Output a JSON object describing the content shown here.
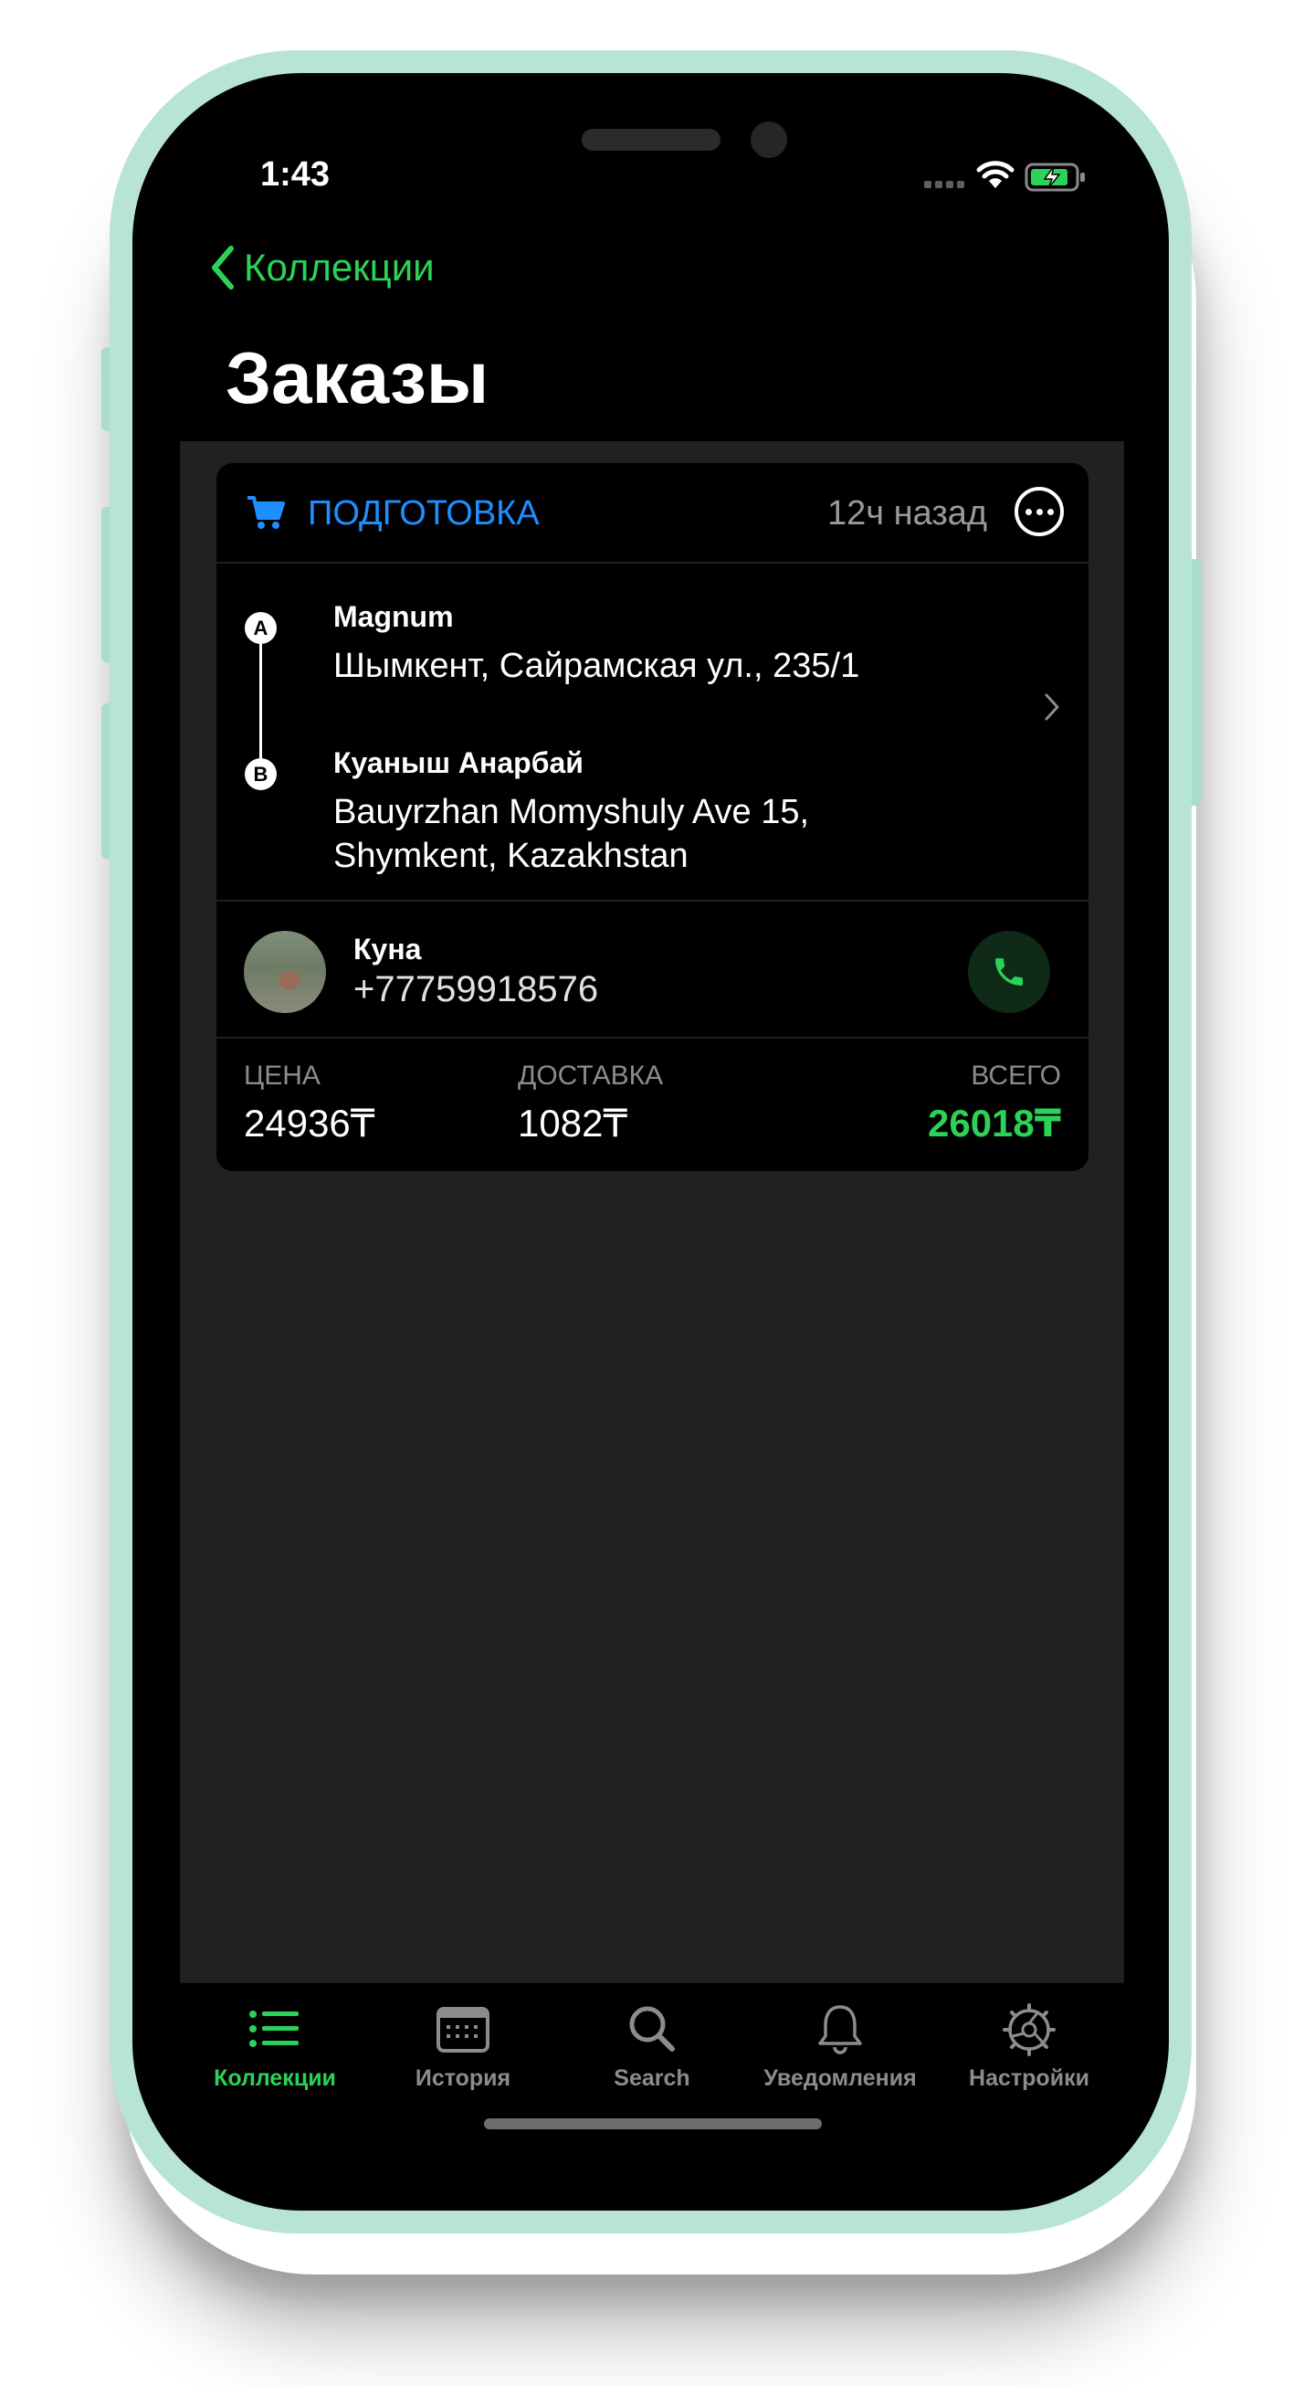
{
  "status_bar": {
    "time": "1:43"
  },
  "nav": {
    "back_label": "Коллекции",
    "title": "Заказы"
  },
  "order": {
    "status": "ПОДГОТОВКА",
    "time_ago": "12ч назад",
    "pickup": {
      "marker": "A",
      "name": "Magnum",
      "address": "Шымкент, Сайрамская ул., 235/1"
    },
    "dropoff": {
      "marker": "B",
      "name": "Куаныш Анарбай",
      "address_line1": "Bauyrzhan Momyshuly Ave 15,",
      "address_line2": "Shymkent, Kazakhstan"
    },
    "contact": {
      "name": "Куна",
      "phone": "+77759918576"
    },
    "totals": {
      "price_label": "ЦЕНА",
      "price": "24936₸",
      "delivery_label": "ДОСТАВКА",
      "delivery": "1082₸",
      "total_label": "ВСЕГО",
      "total": "26018₸"
    }
  },
  "tabs": [
    {
      "label": "Коллекции",
      "icon": "list-icon",
      "active": true
    },
    {
      "label": "История",
      "icon": "calendar-icon",
      "active": false
    },
    {
      "label": "Search",
      "icon": "search-icon",
      "active": false
    },
    {
      "label": "Уведомления",
      "icon": "bell-icon",
      "active": false
    },
    {
      "label": "Настройки",
      "icon": "gear-icon",
      "active": false
    }
  ],
  "colors": {
    "accent": "#2cd158",
    "status_blue": "#1e8fff",
    "frame": "#b8e4d3",
    "background": "#212121"
  }
}
